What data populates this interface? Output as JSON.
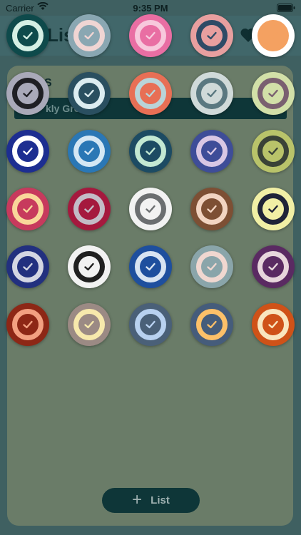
{
  "status_bar": {
    "carrier": "Carrier",
    "time": "9:35 PM"
  },
  "header": {
    "title": "List"
  },
  "panel": {
    "label": "S",
    "group_label": "kly Gro"
  },
  "add_button": {
    "label": "List"
  },
  "swatches": [
    {
      "outer": "#0e4a4b",
      "inner": "#d5efe4",
      "check": "#0e4a4b"
    },
    {
      "outer": "#8aa7b2",
      "inner": "#f0d5d3",
      "check": "#8aa7b2"
    },
    {
      "outer": "#e96ea3",
      "inner": "#f7c8dc",
      "check": "#e96ea3"
    },
    {
      "outer": "#e89f9f",
      "inner": "#2f4b66",
      "check": "#e89f9f"
    },
    {
      "outer": "#ffffff",
      "inner": "#f4a161",
      "check": "#f4a161"
    },
    {
      "outer": "#a9a9b9",
      "inner": "#1f1f24",
      "check": "#a9a9b9"
    },
    {
      "outer": "#2a4f60",
      "inner": "#dcecf0",
      "check": "#2a4f60"
    },
    {
      "outer": "#e86f55",
      "inner": "#b9d4d8",
      "check": "#e86f55"
    },
    {
      "outer": "#d0dad9",
      "inner": "#5a7880",
      "check": "#d0dad9"
    },
    {
      "outer": "#d2e0a8",
      "inner": "#7a6070",
      "check": "#d2e0a8"
    },
    {
      "outer": "#1d2e91",
      "inner": "#ffffff",
      "check": "#1d2e91"
    },
    {
      "outer": "#2a77b5",
      "inner": "#d4e7f4",
      "check": "#2a77b5"
    },
    {
      "outer": "#1d4b63",
      "inner": "#c3e8d2",
      "check": "#1d4b63"
    },
    {
      "outer": "#3e4d98",
      "inner": "#d9c7e4",
      "check": "#3e4d98"
    },
    {
      "outer": "#b9c36a",
      "inner": "#3a4237",
      "check": "#b9c36a"
    },
    {
      "outer": "#c73a5d",
      "inner": "#f9d79a",
      "check": "#c73a5d"
    },
    {
      "outer": "#a5193e",
      "inner": "#c3bcc7",
      "check": "#a5193e"
    },
    {
      "outer": "#f2f2f2",
      "inner": "#6b6e70",
      "check": "#f2f2f2"
    },
    {
      "outer": "#7d4f34",
      "inner": "#f2d4c2",
      "check": "#7d4f34"
    },
    {
      "outer": "#f1efa5",
      "inner": "#1f2338",
      "check": "#f1efa5"
    },
    {
      "outer": "#22307f",
      "inner": "#d4d6e3",
      "check": "#22307f"
    },
    {
      "outer": "#f2f2f2",
      "inner": "#202020",
      "check": "#f2f2f2"
    },
    {
      "outer": "#1e4f9e",
      "inner": "#d8e4f2",
      "check": "#1e4f9e"
    },
    {
      "outer": "#8aa5aa",
      "inner": "#f0d7d0",
      "check": "#8aa5aa"
    },
    {
      "outer": "#5a2a62",
      "inner": "#e7d6dc",
      "check": "#5a2a62"
    },
    {
      "outer": "#8d2716",
      "inner": "#f3a081",
      "check": "#8d2716"
    },
    {
      "outer": "#9b8a84",
      "inner": "#f7e9ac",
      "check": "#9b8a84"
    },
    {
      "outer": "#4a6078",
      "inner": "#b8d1f0",
      "check": "#4a6078"
    },
    {
      "outer": "#455c7b",
      "inner": "#fcc069",
      "check": "#455c7b"
    },
    {
      "outer": "#cf5218",
      "inner": "#f9e6bf",
      "check": "#cf5218"
    }
  ]
}
